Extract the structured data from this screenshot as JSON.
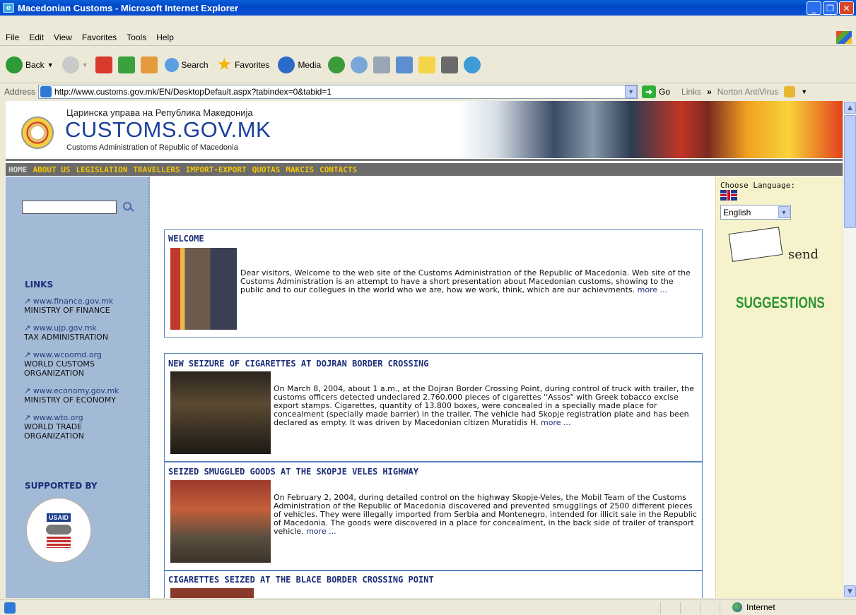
{
  "window": {
    "title": "Macedonian Customs - Microsoft Internet Explorer"
  },
  "menu": [
    "File",
    "Edit",
    "View",
    "Favorites",
    "Tools",
    "Help"
  ],
  "toolbar": {
    "back": "Back",
    "search": "Search",
    "favorites": "Favorites",
    "media": "Media"
  },
  "address": {
    "label": "Address",
    "url": "http://www.customs.gov.mk/EN/DesktopDefault.aspx?tabindex=0&tabid=1",
    "go": "Go",
    "links": "Links",
    "norton": "Norton AntiVirus"
  },
  "status": {
    "zone": "Internet"
  },
  "site": {
    "header_cyrillic": "Царинска управа на Република Македонија",
    "header_title": "CUSTOMS.GOV.MK",
    "header_sub": "Customs Administration of Republic of Macedonia",
    "nav": [
      "HOME",
      "ABOUT US",
      "LEGISLATION",
      "TRAVELLERS",
      "IMPORT-EXPORT",
      "QUOTAS",
      "MAKCIS",
      "CONTACTS"
    ],
    "links_heading": "LINKS",
    "links": [
      {
        "url": "www.finance.gov.mk",
        "name": "MINISTRY OF FINANCE"
      },
      {
        "url": "www.ujp.gov.mk",
        "name": "TAX ADMINISTRATION"
      },
      {
        "url": "www.wcoomd.org",
        "name": "WORLD CUSTOMS ORGANIZATION"
      },
      {
        "url": "www.economy.gov.mk",
        "name": "MINISTRY OF ECONOMY"
      },
      {
        "url": "www.wto.org",
        "name": "WORLD TRADE ORGANIZATION"
      }
    ],
    "supported_by": "SUPPORTED BY",
    "usaid": "USAID",
    "choose_language": "Choose Language:",
    "language": "English",
    "send": "send",
    "suggestions": "SUGGESTIONS",
    "articles": [
      {
        "title": "WELCOME",
        "body": "Dear visitors, Welcome to the web site of the Customs Administration of the Republic of Macedonia. Web site of the Customs Administration is an attempt to have a short presentation about Macedonian customs, showing to the public and to our collegues in the world who we are, how we work, think, which are our achievments.",
        "more": "more ..."
      },
      {
        "title": "NEW SEIZURE OF CIGARETTES AT DOJRAN BORDER CROSSING",
        "body": "On March 8, 2004, about 1 a.m., at the Dojran Border Crossing Point, during control of truck with trailer, the customs officers detected undeclared 2.760.000 pieces of cigarettes ''Assos\" with Greek tobacco excise export stamps. Cigarettes, quantity of 13.800 boxes, were concealed in a specially made place for concealment (specially made barrier) in the trailer. The vehicle had Skopje registration plate and has been declared as empty. It was driven by Macedonian citizen Muratidis H.",
        "more": "more ..."
      },
      {
        "title": "SEIZED SMUGGLED GOODS AT THE SKOPJE VELES HIGHWAY",
        "body": "On February 2, 2004, during detailed control on the highway Skopje-Veles, the Mobil Team of the Customs Administration of the Republic of Macedonia discovered and prevented smugglings of 2500 different pieces of vehicles. They were illegally imported from Serbia and Montenegro, intended for illicit sale in the Republic of Macedonia. The goods were discovered in a place for concealment, in the back side of trailer of transport vehicle.",
        "more": "more ..."
      },
      {
        "title": "CIGARETTES SEIZED AT THE BLACE BORDER CROSSING POINT"
      }
    ]
  },
  "colors": {
    "title_bar": "#0048c8",
    "nav_link": "#f5c400",
    "left_column": "#a3bad6",
    "right_column": "#f6f3cc",
    "suggestions": "#2b9532",
    "heading": "#1c2e78"
  }
}
